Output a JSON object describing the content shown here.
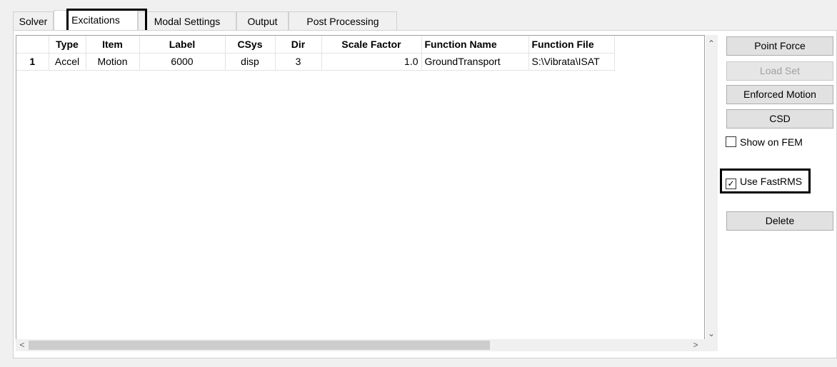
{
  "tabs": [
    "Solver",
    "Excitations",
    "Modal Settings",
    "Output",
    "Post Processing"
  ],
  "table": {
    "columns": [
      "",
      "Type",
      "Item",
      "Label",
      "CSys",
      "Dir",
      "Scale Factor",
      "Function Name",
      "Function File"
    ],
    "rows": [
      [
        "1",
        "Accel",
        "Motion",
        "6000",
        "disp",
        "3",
        "1.0",
        "GroundTransport",
        "S:\\Vibrata\\ISAT"
      ]
    ]
  },
  "buttons": {
    "point_force": "Point Force",
    "load_set": "Load Set",
    "enforced_motion": "Enforced Motion",
    "csd": "CSD",
    "delete": "Delete"
  },
  "checkboxes": {
    "show_on_fem": {
      "label": "Show on FEM",
      "checked": false
    },
    "use_fastrms": {
      "label": "Use FastRMS",
      "checked": true
    }
  },
  "icons": {
    "scroll_up": "chevron-up-icon",
    "scroll_down": "chevron-down-icon",
    "scroll_left": "chevron-left-icon",
    "scroll_right": "chevron-right-icon"
  }
}
